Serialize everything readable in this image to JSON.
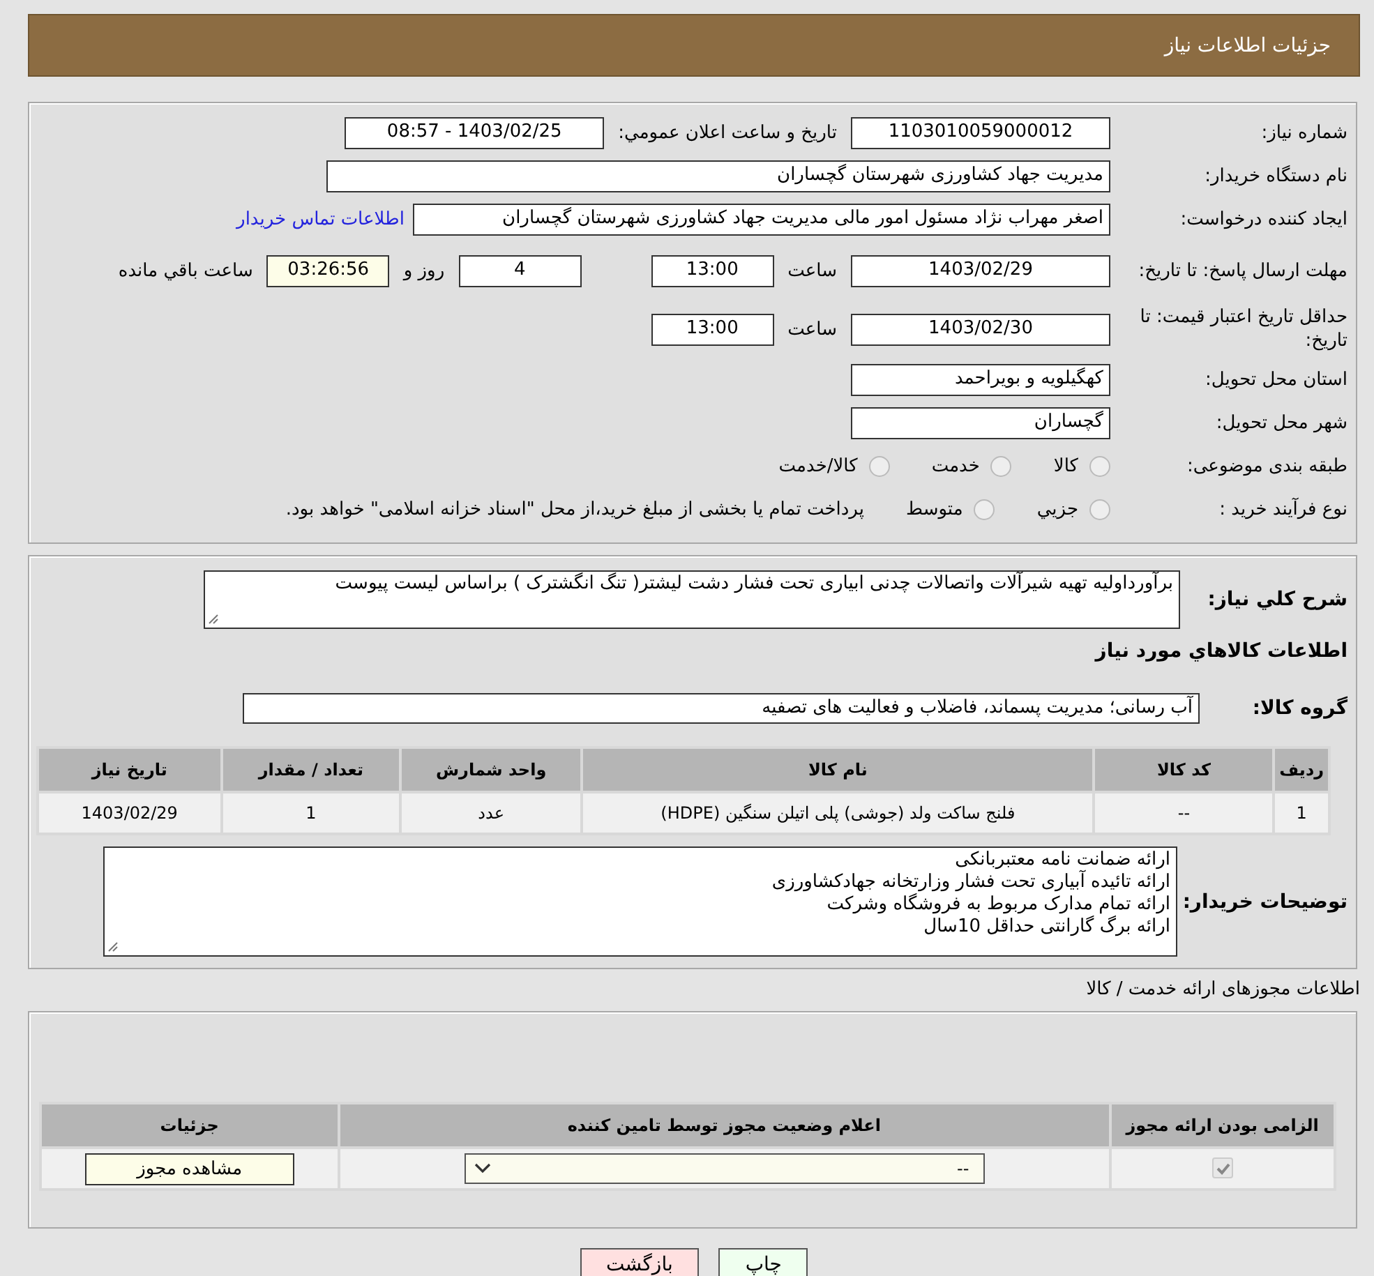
{
  "header": {
    "title": "جزئیات اطلاعات نیاز"
  },
  "need_number": {
    "label": "شماره نیاز:",
    "value": "1103010059000012"
  },
  "announce": {
    "label": "تاريخ و ساعت اعلان عمومي:",
    "value": "1403/02/25 - 08:57"
  },
  "buyer_org": {
    "label": "نام دستگاه خریدار:",
    "value": "مدیریت جهاد کشاورزی شهرستان گچساران"
  },
  "creator": {
    "label": "ایجاد کننده درخواست:",
    "value": "اصغر مهراب نژاد مسئول امور مالی مدیریت جهاد کشاورزی شهرستان گچساران",
    "link": "اطلاعات تماس خریدار"
  },
  "deadline": {
    "label": "مهلت ارسال پاسخ: تا تاریخ:",
    "date": "1403/02/29",
    "time_label": "ساعت",
    "time": "13:00",
    "days": "4",
    "days_label": "روز و",
    "remaining": "03:26:56",
    "remaining_label": "ساعت باقي مانده"
  },
  "validity": {
    "label": "حداقل تاریخ اعتبار قیمت: تا تاریخ:",
    "date": "1403/02/30",
    "time_label": "ساعت",
    "time": "13:00"
  },
  "province": {
    "label": "استان محل تحویل:",
    "value": "کهگیلویه و بویراحمد"
  },
  "city": {
    "label": "شهر محل تحویل:",
    "value": "گچساران"
  },
  "category": {
    "label": "طبقه بندی موضوعی:",
    "options": [
      {
        "label": "کالا",
        "selected": false
      },
      {
        "label": "خدمت",
        "selected": false
      },
      {
        "label": "کالا/خدمت",
        "selected": false
      }
    ]
  },
  "purchase_type": {
    "label": "نوع فرآیند خرید :",
    "options": [
      {
        "label": "جزيي",
        "selected": false
      },
      {
        "label": "متوسط",
        "selected": false
      }
    ],
    "note": "پرداخت تمام یا بخشی از مبلغ خرید،از محل \"اسناد خزانه اسلامی\" خواهد بود."
  },
  "description": {
    "label": "شرح کلي نیاز:",
    "value": "برآورداولیه تهیه شیرآلات واتصالات چدنی ابیاری تحت فشار دشت لیشتر( تنگ انگشترک ) براساس لیست پیوست"
  },
  "goods_heading": "اطلاعات کالاهاي مورد نیاز",
  "goods_group": {
    "label": "گروه کالا:",
    "value": "آب رسانی؛ مدیریت پسماند، فاضلاب و فعالیت های تصفیه"
  },
  "goods_table": {
    "columns": [
      "ردیف",
      "کد کالا",
      "نام کالا",
      "واحد شمارش",
      "تعداد / مقدار",
      "تاریخ نیاز"
    ],
    "rows": [
      [
        "1",
        "--",
        "فلنج ساکت ولد (جوشی) پلی اتیلن سنگین (HDPE)",
        "عدد",
        "1",
        "1403/02/29"
      ]
    ]
  },
  "buyer_notes": {
    "label": "توضیحات خریدار:",
    "lines": [
      "ارائه ضمانت نامه معتبربانکی",
      "ارائه تائیده آبیاری تحت فشار وزارتخانه  جهادکشاورزی",
      "ارائه تمام مدارک مربوط به فروشگاه وشرکت",
      "ارائه برگ گارانتی حداقل 10سال"
    ]
  },
  "licenses": {
    "title": "اطلاعات مجوزهای ارائه خدمت / کالا",
    "columns": [
      "الزامی بودن ارائه مجوز",
      "اعلام وضعیت مجوز توسط تامین کننده",
      "جزئیات"
    ],
    "rows": [
      {
        "required": true,
        "status": "--",
        "details_button": "مشاهده مجوز"
      }
    ]
  },
  "buttons": [
    {
      "label": "چاپ",
      "kind": "print"
    },
    {
      "label": "بازگشت",
      "kind": "back"
    }
  ]
}
